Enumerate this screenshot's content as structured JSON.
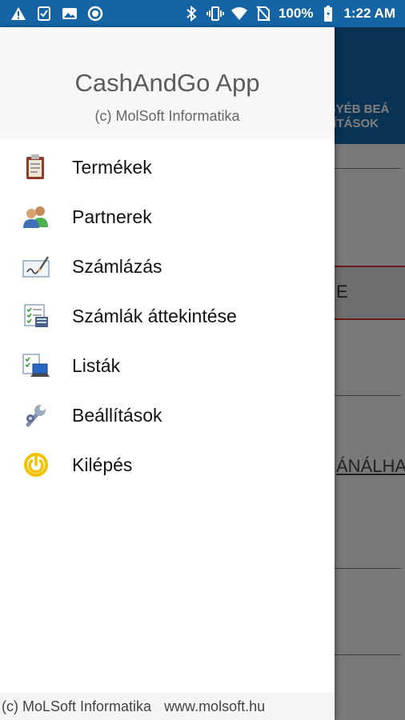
{
  "status_bar": {
    "battery": "100%",
    "time": "1:22 AM",
    "icons": [
      "warning-icon",
      "checklist-icon",
      "image-icon",
      "circle-icon",
      "bluetooth-icon",
      "vibrate-icon",
      "wifi-icon",
      "no-sim-icon",
      "battery-icon"
    ]
  },
  "background_app": {
    "tab_line1": "EGYÉB BEÁ",
    "tab_line2": "LLÍTÁSOK",
    "box_text": "E",
    "row_text": "ÁNÁLHAT",
    "colors": {
      "header": "#1565a6",
      "box_border": "#d32f2f"
    }
  },
  "drawer": {
    "title": "CashAndGo App",
    "subtitle": "(c) MolSoft Informatika",
    "items": [
      {
        "label": "Termékek",
        "icon": "clipboard-icon"
      },
      {
        "label": "Partnerek",
        "icon": "users-icon"
      },
      {
        "label": "Számlázás",
        "icon": "invoice-sign-icon"
      },
      {
        "label": "Számlák áttekintése",
        "icon": "invoice-list-icon"
      },
      {
        "label": "Listák",
        "icon": "list-computer-icon"
      },
      {
        "label": "Beállítások",
        "icon": "wrench-icon"
      },
      {
        "label": "Kilépés",
        "icon": "power-icon"
      }
    ],
    "footer_left": "(c) MoLSoft Informatika",
    "footer_right": "www.molsoft.hu"
  }
}
